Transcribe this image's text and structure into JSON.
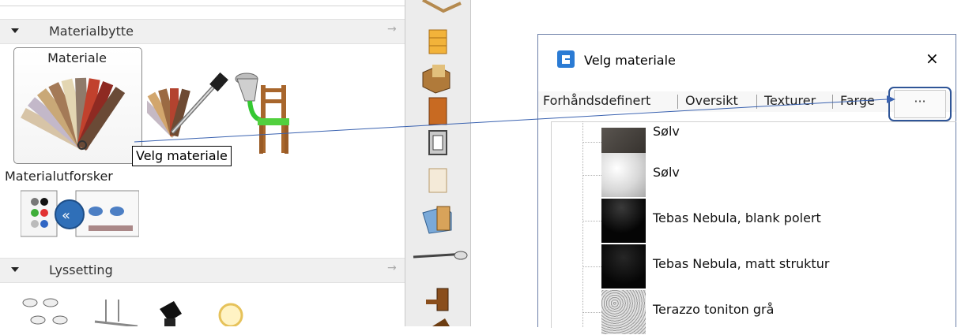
{
  "sections": {
    "materialbytte": "Materialbytte",
    "lyssetting": "Lyssetting"
  },
  "tools": {
    "materiale_label": "Materiale",
    "tooltip": "Velg materiale",
    "materialutforsker_label": "Materialutforsker"
  },
  "dialog": {
    "title": "Velg materiale",
    "close": "×",
    "tabs": [
      "Forhåndsdefinert",
      "Oversikt",
      "Texturer",
      "Farge"
    ],
    "more_button": "···",
    "items": [
      {
        "label": "Sølv",
        "swatch": "#4a453f"
      },
      {
        "label": "Sølv",
        "swatch": "#e6e6e6"
      },
      {
        "label": "Tebas Nebula, blank polert",
        "swatch": "#0a0a0a"
      },
      {
        "label": "Tebas Nebula, matt struktur",
        "swatch": "#101010"
      },
      {
        "label": "Terazzo toniton grå",
        "swatch": "#bfbfbf"
      }
    ]
  },
  "colors": {
    "accent_line": "#3a62b0",
    "highlight_border": "#2f5597",
    "logo_blue": "#2b7bd4"
  },
  "icons": [
    "expand-triangle-icon",
    "pin-arrow-icon",
    "color-swatch-fan-icon",
    "eyedropper-icon",
    "paint-bucket-chair-icon",
    "material-explorer-icon",
    "light-fixture-icon",
    "cabinet-icon",
    "app-logo-icon"
  ]
}
